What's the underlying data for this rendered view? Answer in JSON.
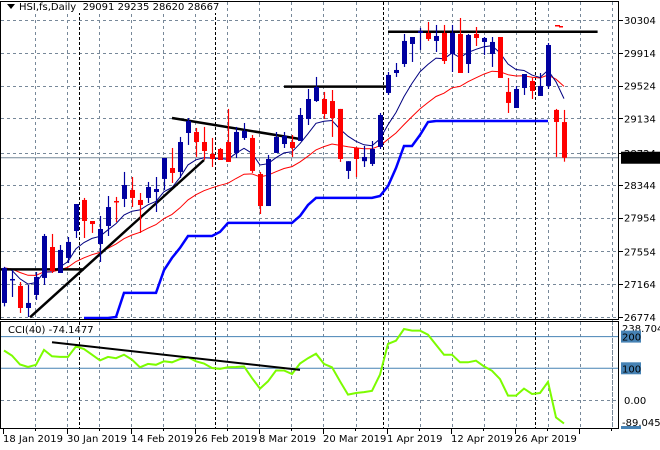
{
  "chart_data": {
    "type": "candlestick",
    "symbol_header": {
      "symbol": "HSI,fs,Daily",
      "open": "29091",
      "high": "29235",
      "low": "28620",
      "close": "28667"
    },
    "price_axis": {
      "ticks": [
        "30304",
        "29914",
        "29524",
        "29134",
        "28724",
        "28344",
        "27954",
        "27554",
        "27164",
        "26774"
      ],
      "range": [
        26774,
        30304
      ],
      "current_price_label": "28667",
      "current_price": 28667
    },
    "date_axis": {
      "labels": [
        "18 Jan 2019",
        "30 Jan 2019",
        "14 Feb 2019",
        "26 Feb 2019",
        "8 Mar 2019",
        "20 Mar 2019",
        "1 Apr 2019",
        "12 Apr 2019",
        "26 Apr 2019"
      ],
      "label_bar_index": [
        0,
        8,
        16,
        24,
        32,
        40,
        48,
        56,
        64
      ],
      "month_start_index": [
        10,
        27,
        48,
        67
      ]
    },
    "candles_ohlc": [
      [
        26941,
        27370,
        26900,
        27357
      ],
      [
        27215,
        27333,
        27012,
        27226
      ],
      [
        27143,
        27190,
        26822,
        26881
      ],
      [
        26881,
        27155,
        26774,
        26941
      ],
      [
        27036,
        27309,
        26976,
        27250
      ],
      [
        27238,
        27761,
        27155,
        27737
      ],
      [
        27606,
        27761,
        27297,
        27321
      ],
      [
        27297,
        27630,
        27297,
        27571
      ],
      [
        27476,
        27725,
        27416,
        27666
      ],
      [
        27796,
        28117,
        27713,
        28117
      ],
      [
        28165,
        28189,
        27713,
        27915
      ],
      [
        27915,
        27915,
        27773,
        27879
      ],
      [
        27642,
        27975,
        27428,
        27820
      ],
      [
        27856,
        28212,
        27737,
        28081
      ],
      [
        28153,
        28201,
        27903,
        28141
      ],
      [
        28177,
        28498,
        28081,
        28343
      ],
      [
        28284,
        28438,
        28081,
        28189
      ],
      [
        28165,
        28248,
        27773,
        28105
      ],
      [
        28189,
        28379,
        28129,
        28319
      ],
      [
        28260,
        28438,
        28022,
        28295
      ],
      [
        28415,
        28664,
        28284,
        28664
      ],
      [
        28545,
        28783,
        28367,
        28486
      ],
      [
        28498,
        28914,
        28427,
        28854
      ],
      [
        28961,
        29139,
        28819,
        29104
      ],
      [
        28973,
        29021,
        28676,
        28854
      ],
      [
        28854,
        29033,
        28640,
        28747
      ],
      [
        28712,
        28902,
        28557,
        28652
      ],
      [
        28771,
        28783,
        28640,
        28640
      ],
      [
        28854,
        29247,
        28617,
        28617
      ],
      [
        28724,
        29033,
        28664,
        28973
      ],
      [
        28902,
        29080,
        28878,
        28985
      ],
      [
        28902,
        28937,
        28486,
        28510
      ],
      [
        28474,
        28498,
        27998,
        28093
      ],
      [
        28093,
        28700,
        28093,
        28652
      ],
      [
        28724,
        28973,
        28724,
        28914
      ],
      [
        28830,
        28973,
        28783,
        28925
      ],
      [
        28854,
        28937,
        28676,
        28783
      ],
      [
        28866,
        29258,
        28866,
        29175
      ],
      [
        29127,
        29484,
        29056,
        29365
      ],
      [
        29341,
        29627,
        29330,
        29508
      ],
      [
        29365,
        29449,
        29127,
        29187
      ],
      [
        29341,
        29472,
        28914,
        29139
      ],
      [
        29247,
        29247,
        28617,
        28652
      ],
      [
        28510,
        28626,
        28415,
        28626
      ],
      [
        28783,
        28795,
        28438,
        28652
      ],
      [
        28626,
        28807,
        28557,
        28676
      ],
      [
        28593,
        28866,
        28569,
        28771
      ],
      [
        28795,
        29199,
        28771,
        29175
      ],
      [
        29437,
        29686,
        29413,
        29651
      ],
      [
        29674,
        29793,
        29627,
        29710
      ],
      [
        29781,
        30138,
        29746,
        30055
      ],
      [
        30019,
        30102,
        29805,
        30102
      ],
      [
        30150,
        30209,
        29948,
        30174
      ],
      [
        30150,
        30281,
        30055,
        30078
      ],
      [
        30055,
        30245,
        29924,
        30114
      ],
      [
        30150,
        30245,
        29781,
        29817
      ],
      [
        29900,
        30245,
        29686,
        30150
      ],
      [
        30138,
        30328,
        29674,
        29674
      ],
      [
        29781,
        30138,
        29674,
        30126
      ],
      [
        30138,
        30221,
        29995,
        30090
      ],
      [
        30043,
        30102,
        29888,
        30090
      ],
      [
        29900,
        30102,
        29746,
        30043
      ],
      [
        30102,
        30102,
        29615,
        29615
      ],
      [
        29449,
        29615,
        29199,
        29318
      ],
      [
        29258,
        29520,
        29258,
        29484
      ],
      [
        29496,
        29662,
        29413,
        29662
      ],
      [
        29579,
        29615,
        29365,
        29460
      ],
      [
        29401,
        29674,
        29401,
        29520
      ],
      [
        29520,
        30031,
        29484,
        30007
      ],
      [
        29235,
        29247,
        28676,
        29092
      ],
      [
        29091,
        29235,
        28620,
        28667
      ]
    ],
    "fast_ma_period": 8,
    "slow_ma_period": 21,
    "support_step_line": {
      "start_index": 10,
      "values": [
        26762,
        26762,
        26762,
        26762,
        26774,
        27060,
        27060,
        27060,
        27060,
        27060,
        27330,
        27476,
        27595,
        27737,
        27737,
        27737,
        27737,
        27785,
        27892,
        27892,
        27892,
        27892,
        27892,
        27892,
        27892,
        27892,
        27892,
        27975,
        28105,
        28189,
        28189,
        28189,
        28189,
        28189,
        28189,
        28189,
        28189,
        28212,
        28330,
        28545,
        28807,
        28807,
        28937,
        29092,
        29104,
        29104,
        29104,
        29104,
        29104,
        29104,
        29104,
        29104,
        29104,
        29104,
        29104,
        29104,
        29104,
        29104,
        29104
      ]
    },
    "trendlines": [
      {
        "name": "early-horizontal",
        "from": [
          -0.5,
          27340
        ],
        "to": [
          10,
          27340
        ]
      },
      {
        "name": "rising-trendline",
        "from": [
          3.25,
          26770
        ],
        "to": [
          25,
          28640
        ]
      },
      {
        "name": "descending-trendline",
        "from": [
          21,
          29139
        ],
        "to": [
          37,
          28890
        ]
      },
      {
        "name": "march-resistance",
        "from": [
          35,
          29512
        ],
        "to": [
          48,
          29512
        ]
      },
      {
        "name": "april-resistance",
        "from": [
          48,
          30165
        ],
        "to": [
          74.2,
          30165
        ]
      }
    ],
    "cci": {
      "label": "CCI(40) -74.1477",
      "period": 40,
      "axis_labels": {
        "max": "238.704",
        "level_high": "200",
        "level_mid": "100",
        "zero": "0.00",
        "min": "-89.0454"
      },
      "range": [
        -89.0454,
        238.704
      ],
      "levels": [
        200,
        100
      ],
      "values": [
        156,
        140,
        112,
        104,
        111,
        158,
        138,
        136,
        136,
        169,
        161,
        143,
        125,
        136,
        132,
        143,
        127,
        103,
        114,
        111,
        122,
        119,
        129,
        135,
        122,
        115,
        101,
        98,
        103,
        104,
        106,
        69,
        36,
        59,
        93,
        93,
        82,
        115,
        132,
        146,
        114,
        103,
        59,
        17,
        22,
        25,
        29,
        80,
        177,
        187,
        224,
        219,
        219,
        206,
        174,
        143,
        143,
        119,
        119,
        124,
        106,
        92,
        66,
        14,
        14,
        36,
        19,
        22,
        57,
        -55,
        -74.1477
      ],
      "trendline": {
        "from": [
          6,
          182
        ],
        "to": [
          37,
          95
        ]
      }
    },
    "colors": {
      "bull": "#0000a0",
      "bear": "#ff0000",
      "fast_ma": "#000080",
      "slow_ma": "#ff0000",
      "support": "#0000ff",
      "cci": "#7cfc00",
      "level": "#4682b4",
      "trend": "#000000",
      "grid": "#778899"
    }
  }
}
